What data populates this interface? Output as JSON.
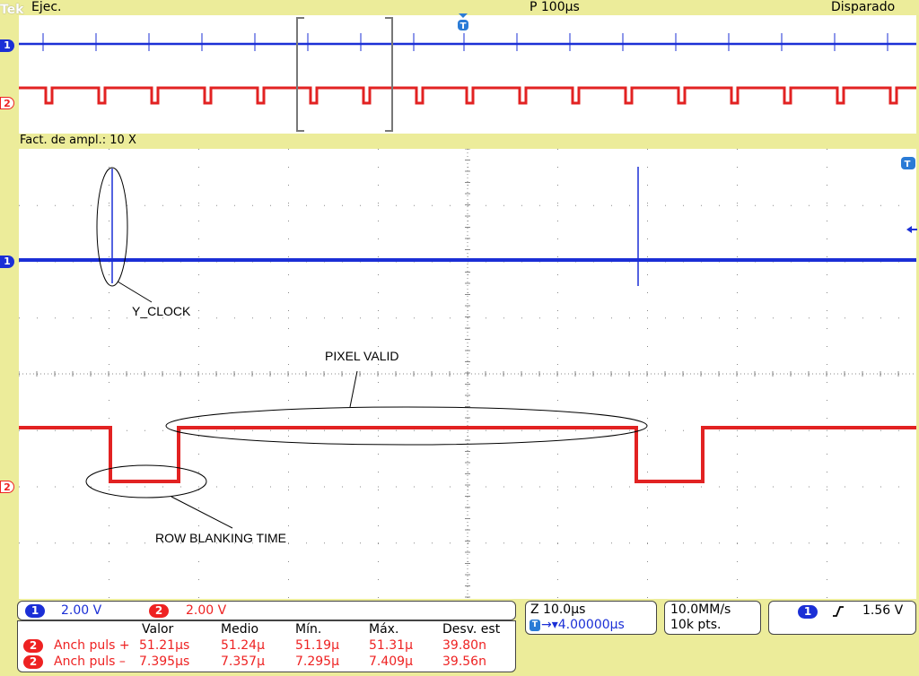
{
  "status_bar": {
    "brand": "Tek",
    "run_state": "Ejec.",
    "horizontal_position": "P 100µs",
    "trigger_state": "Disparado"
  },
  "zoom_label": "Fact. de ampl.: 10 X",
  "channel_markers": {
    "ch1": "1",
    "ch2": "2",
    "trigger_marker": "T"
  },
  "annotations": {
    "y_clock": "Y_CLOCK",
    "pixel_valid": "PIXEL VALID",
    "row_blanking": "ROW BLANKING TIME"
  },
  "channel_settings": {
    "ch1_badge": "1",
    "ch1_scale": "2.00 V",
    "ch2_badge": "2",
    "ch2_scale": "2.00 V"
  },
  "timebase": {
    "zoom_scale": "Z 10.0µs",
    "trigger_offset": "→▾4.00000µs",
    "sample_rate": "10.0MM/s",
    "record_length": "10k pts."
  },
  "trigger": {
    "source": "1",
    "level": "1.56 V"
  },
  "measurements": {
    "headers": [
      "Valor",
      "Medio",
      "Mín.",
      "Máx.",
      "Desv. est"
    ],
    "rows": [
      {
        "ch": "2",
        "name": "Anch puls +",
        "value": "51.21µs",
        "mean": "51.24µ",
        "min": "51.19µ",
        "max": "51.31µ",
        "std": "39.80n"
      },
      {
        "ch": "2",
        "name": "Anch puls –",
        "value": "7.395µs",
        "mean": "7.357µ",
        "min": "7.295µ",
        "max": "7.409µ",
        "std": "39.56n"
      }
    ]
  },
  "colors": {
    "background": "#ecec9a",
    "ch1": "#1b2fd6",
    "ch2": "#e22222",
    "grid": "#888888"
  }
}
